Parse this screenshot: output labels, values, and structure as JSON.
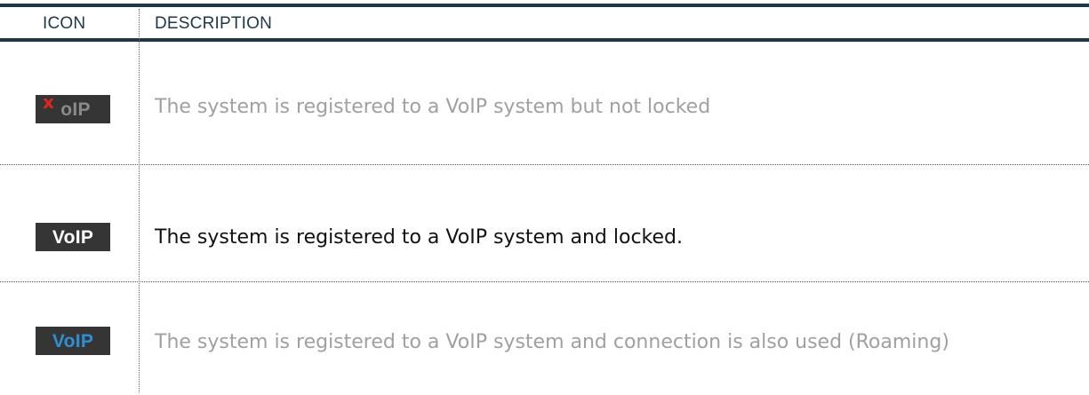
{
  "header": {
    "icon_label": "ICON",
    "description_label": "DESCRIPTION"
  },
  "rows": [
    {
      "icon": "voip-not-locked-icon",
      "icon_text": "oIP",
      "icon_mark": "x",
      "description": "The system is registered to a VoIP system but not locked"
    },
    {
      "icon": "voip-locked-icon",
      "icon_text": "VoIP",
      "description": "The system is registered to a VoIP system and locked."
    },
    {
      "icon": "voip-roaming-icon",
      "icon_text": "VoIP",
      "description": "The system is registered to a VoIP system and connection is also used (Roaming)"
    }
  ],
  "colors": {
    "header_rule": "#1f3848",
    "icon_background": "#353535",
    "mark_red": "#e0261e",
    "roaming_blue": "#2f8fd1",
    "muted_text": "#a0a0a0",
    "active_text": "#111111"
  }
}
